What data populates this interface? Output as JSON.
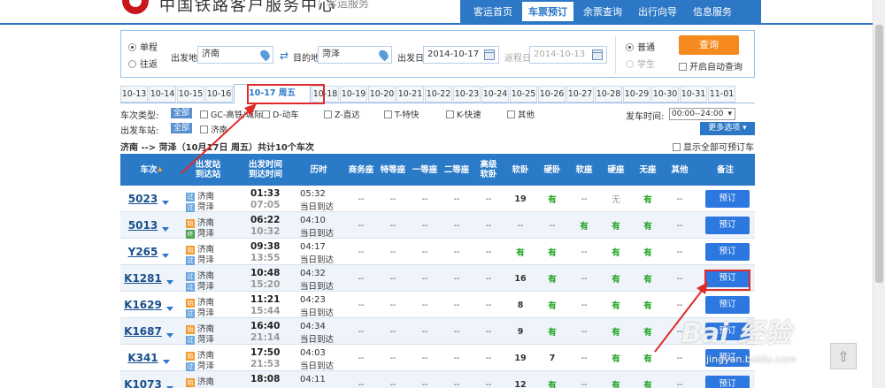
{
  "header": {
    "brand": "中国铁路客户服务中心",
    "brand_sub": "客运服务",
    "nav": [
      "客运首页",
      "车票预订",
      "余票查询",
      "出行向导",
      "信息服务"
    ],
    "nav_active": 1
  },
  "search": {
    "trip_type": [
      "单程",
      "往返"
    ],
    "from_label": "出发地",
    "from_value": "济南",
    "to_label": "目的地",
    "to_value": "菏泽",
    "date_label": "出发日",
    "date_value": "2014-10-17",
    "return_label": "返程日",
    "return_value": "2014-10-13",
    "passenger_types": [
      "普通",
      "学生"
    ],
    "query_button": "查询",
    "auto_query": "开启自动查询"
  },
  "date_tabs": [
    "10-13",
    "10-14",
    "10-15",
    "10-16",
    "10-17 周五",
    "10-18",
    "10-19",
    "10-20",
    "10-21",
    "10-22",
    "10-23",
    "10-24",
    "10-25",
    "10-26",
    "10-27",
    "10-28",
    "10-29",
    "10-30",
    "10-31",
    "11-01"
  ],
  "date_active": 4,
  "filter": {
    "type_label": "车次类型:",
    "all": "全部",
    "types": [
      "GC-高铁/城际",
      "D-动车",
      "Z-直达",
      "T-特快",
      "K-快速",
      "其他"
    ],
    "time_label": "发车时间:",
    "time_value": "00:00--24:00",
    "station_label": "出发车站:",
    "stations": [
      "济南"
    ],
    "more_options": "更多选项"
  },
  "summary": {
    "route": "济南 --> 菏泽（10月17日  周五）共计10个车次",
    "show_all": "显示全部可预订车次"
  },
  "table": {
    "headers": [
      "车次",
      "出发站\n到达站",
      "出发时间\n到达时间",
      "历时",
      "商务座",
      "特等座",
      "一等座",
      "二等座",
      "高级\n软卧",
      "软卧",
      "硬卧",
      "软座",
      "硬座",
      "无座",
      "其他",
      "备注"
    ],
    "book_label": "预订",
    "rows": [
      {
        "no": "5023",
        "from": "济南",
        "to": "菏泽",
        "ft": "g",
        "tt": "g",
        "dep": "01:33",
        "arr": "07:05",
        "dur": "05:32",
        "day": "当日到达",
        "seats": [
          "--",
          "--",
          "--",
          "--",
          "--",
          "19",
          "有",
          "--",
          "无",
          "有",
          "--"
        ]
      },
      {
        "no": "5013",
        "from": "济南",
        "to": "菏泽",
        "ft": "s",
        "tt": "z",
        "dep": "06:22",
        "arr": "10:32",
        "dur": "04:10",
        "day": "当日到达",
        "seats": [
          "--",
          "--",
          "--",
          "--",
          "--",
          "--",
          "--",
          "有",
          "有",
          "有",
          "--"
        ]
      },
      {
        "no": "Y265",
        "from": "济南",
        "to": "菏泽",
        "ft": "s",
        "tt": "g",
        "dep": "09:38",
        "arr": "13:55",
        "dur": "04:17",
        "day": "当日到达",
        "seats": [
          "--",
          "--",
          "--",
          "--",
          "--",
          "有",
          "有",
          "--",
          "有",
          "有",
          "--"
        ]
      },
      {
        "no": "K1281",
        "from": "济南",
        "to": "菏泽",
        "ft": "g",
        "tt": "g",
        "dep": "10:48",
        "arr": "15:20",
        "dur": "04:32",
        "day": "当日到达",
        "seats": [
          "--",
          "--",
          "--",
          "--",
          "--",
          "16",
          "有",
          "--",
          "有",
          "有",
          "--"
        ]
      },
      {
        "no": "K1629",
        "from": "济南",
        "to": "菏泽",
        "ft": "s",
        "tt": "g",
        "dep": "11:21",
        "arr": "15:44",
        "dur": "04:23",
        "day": "当日到达",
        "seats": [
          "--",
          "--",
          "--",
          "--",
          "--",
          "8",
          "有",
          "--",
          "有",
          "有",
          "--"
        ]
      },
      {
        "no": "K1687",
        "from": "济南",
        "to": "菏泽",
        "ft": "s",
        "tt": "g",
        "dep": "16:40",
        "arr": "21:14",
        "dur": "04:34",
        "day": "当日到达",
        "seats": [
          "--",
          "--",
          "--",
          "--",
          "--",
          "9",
          "有",
          "--",
          "有",
          "有",
          "--"
        ]
      },
      {
        "no": "K341",
        "from": "济南",
        "to": "菏泽",
        "ft": "s",
        "tt": "g",
        "dep": "17:50",
        "arr": "21:53",
        "dur": "04:03",
        "day": "当日到达",
        "seats": [
          "--",
          "--",
          "--",
          "--",
          "--",
          "19",
          "7",
          "--",
          "有",
          "有",
          "--"
        ]
      },
      {
        "no": "K1073",
        "from": "济南",
        "to": "菏泽",
        "ft": "s",
        "tt": "g",
        "dep": "18:08",
        "arr": "",
        "dur": "04:11",
        "day": "",
        "seats": [
          "--",
          "--",
          "--",
          "--",
          "--",
          "12",
          "有",
          "--",
          "有",
          "有",
          "--"
        ]
      }
    ]
  },
  "watermark": {
    "main": "Bai 经验",
    "sub": "jingyan.baidu.com"
  },
  "colors": {
    "accent": "#2c77c6",
    "available": "#1aa11a",
    "query": "#f78a1e",
    "highlight": "#e02b2b"
  }
}
